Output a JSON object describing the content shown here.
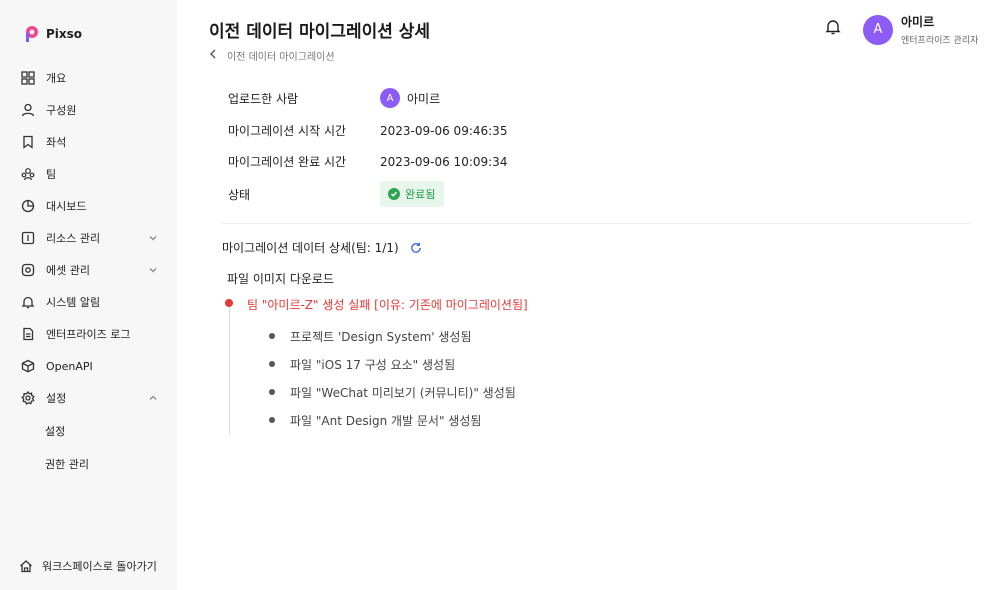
{
  "app": {
    "logo_text": "Pixso",
    "brand_color": "#8b5cf6"
  },
  "sidebar": {
    "items": [
      {
        "label": "개요",
        "icon": "overview-icon"
      },
      {
        "label": "구성원",
        "icon": "user-icon"
      },
      {
        "label": "좌석",
        "icon": "bookmark-icon"
      },
      {
        "label": "팀",
        "icon": "team-icon"
      },
      {
        "label": "대시보드",
        "icon": "dashboard-icon"
      },
      {
        "label": "리소스 관리",
        "icon": "resource-icon",
        "expandable": true
      },
      {
        "label": "에셋 관리",
        "icon": "asset-icon",
        "expandable": true
      },
      {
        "label": "시스템 알림",
        "icon": "bell-icon"
      },
      {
        "label": "엔터프라이즈 로그",
        "icon": "log-icon"
      },
      {
        "label": "OpenAPI",
        "icon": "cube-icon"
      },
      {
        "label": "설정",
        "icon": "gear-icon",
        "expanded": true
      }
    ],
    "settings_sub": [
      "설정",
      "권한 관리"
    ],
    "back_label": "워크스페이스로 돌아가기"
  },
  "header": {
    "title": "이전 데이터 마이그레이션 상세",
    "breadcrumb": "이전 데이터 마이그레이션",
    "user": {
      "initial": "A",
      "name": "아미르",
      "role": "엔터프라이즈 관리자"
    }
  },
  "details": {
    "uploader_label": "업로드한 사람",
    "uploader_initial": "A",
    "uploader_name": "아미르",
    "start_label": "마이그레이션 시작 시간",
    "start_value": "2023-09-06 09:46:35",
    "end_label": "마이그레이션 완료 시간",
    "end_value": "2023-09-06 10:09:34",
    "status_label": "상태",
    "status_value": "완료됨",
    "status_color": "#1f9a45"
  },
  "migration": {
    "section_title": "마이그레이션 데이터 상세(팀: 1/1)",
    "sub_title": "파일 이미지 다운로드",
    "error_text": "팀 \"아미르-Z\" 생성 실패 [이유: 기존에 마이그레이션됨]",
    "error_color": "#e53935",
    "items": [
      "프로젝트 'Design System' 생성됨",
      "파일 \"iOS 17 구성 요소\" 생성됨",
      "파일 \"WeChat 미리보기 (커뮤니티)\" 생성됨",
      "파일 \"Ant Design 개발 문서\" 생성됨"
    ]
  }
}
